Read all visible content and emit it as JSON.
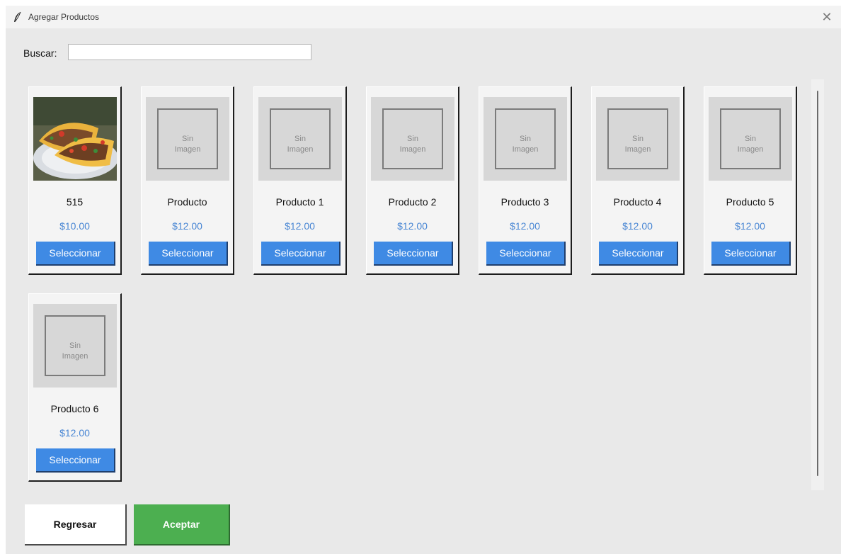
{
  "window": {
    "title": "Agregar Productos",
    "close_glyph": "✕",
    "icon": "feather-icon"
  },
  "search": {
    "label": "Buscar:",
    "value": "",
    "placeholder": ""
  },
  "products": [
    {
      "name": "515",
      "price": "$10.00",
      "has_image": true,
      "select_label": "Seleccionar"
    },
    {
      "name": "Producto",
      "price": "$12.00",
      "has_image": false,
      "no_image_text": "Sin\nImagen",
      "select_label": "Seleccionar"
    },
    {
      "name": "Producto 1",
      "price": "$12.00",
      "has_image": false,
      "no_image_text": "Sin\nImagen",
      "select_label": "Seleccionar"
    },
    {
      "name": "Producto 2",
      "price": "$12.00",
      "has_image": false,
      "no_image_text": "Sin\nImagen",
      "select_label": "Seleccionar"
    },
    {
      "name": "Producto 3",
      "price": "$12.00",
      "has_image": false,
      "no_image_text": "Sin\nImagen",
      "select_label": "Seleccionar"
    },
    {
      "name": "Producto 4",
      "price": "$12.00",
      "has_image": false,
      "no_image_text": "Sin\nImagen",
      "select_label": "Seleccionar"
    },
    {
      "name": "Producto 5",
      "price": "$12.00",
      "has_image": false,
      "no_image_text": "Sin\nImagen",
      "select_label": "Seleccionar"
    },
    {
      "name": "Producto 6",
      "price": "$12.00",
      "has_image": false,
      "no_image_text": "Sin\nImagen",
      "select_label": "Seleccionar"
    }
  ],
  "footer": {
    "back_label": "Regresar",
    "accept_label": "Aceptar"
  },
  "colors": {
    "price": "#4a87d4",
    "select_button": "#3f8ae4",
    "accept_button": "#4caf50"
  }
}
